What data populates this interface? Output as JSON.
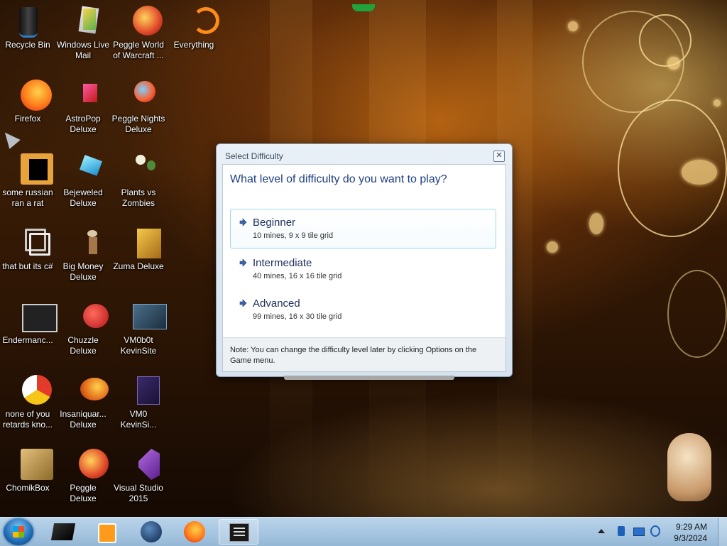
{
  "desktop": {
    "icons": [
      {
        "label": "Recycle Bin"
      },
      {
        "label": "Windows Live Mail"
      },
      {
        "label": "Peggle World of Warcraft ..."
      },
      {
        "label": "Everything"
      },
      {
        "label": "Firefox"
      },
      {
        "label": "AstroPop Deluxe"
      },
      {
        "label": "Peggle Nights Deluxe"
      },
      {
        "label": "some russian ran a rat"
      },
      {
        "label": "Bejeweled Deluxe"
      },
      {
        "label": "Plants vs Zombies"
      },
      {
        "label": "that but its c#"
      },
      {
        "label": "Big Money Deluxe"
      },
      {
        "label": "Zuma Deluxe"
      },
      {
        "label": "Endermanc..."
      },
      {
        "label": "Chuzzle Deluxe"
      },
      {
        "label": "VM0b0t KevinSite"
      },
      {
        "label": "none of you retards kno..."
      },
      {
        "label": "Insaniquar... Deluxe"
      },
      {
        "label": "VM0 KevinSi..."
      },
      {
        "label": "ChomikBox"
      },
      {
        "label": "Peggle Deluxe"
      },
      {
        "label": "Visual Studio 2015"
      }
    ]
  },
  "dialog": {
    "title": "Select Difficulty",
    "question": "What level of difficulty do you want to play?",
    "options": [
      {
        "title": "Beginner",
        "desc": "10 mines, 9 x 9 tile grid",
        "selected": true
      },
      {
        "title": "Intermediate",
        "desc": "40 mines, 16 x 16 tile grid",
        "selected": false
      },
      {
        "title": "Advanced",
        "desc": "99 mines, 16 x 30 tile grid",
        "selected": false
      }
    ],
    "note": "Note: You can change the difficulty level later by clicking Options on the Game menu."
  },
  "taskbar": {
    "time": "9:29 AM",
    "date": "9/3/2024"
  },
  "colors": {
    "accent": "#1e3f80",
    "taskbar": "#a6c5e0"
  }
}
